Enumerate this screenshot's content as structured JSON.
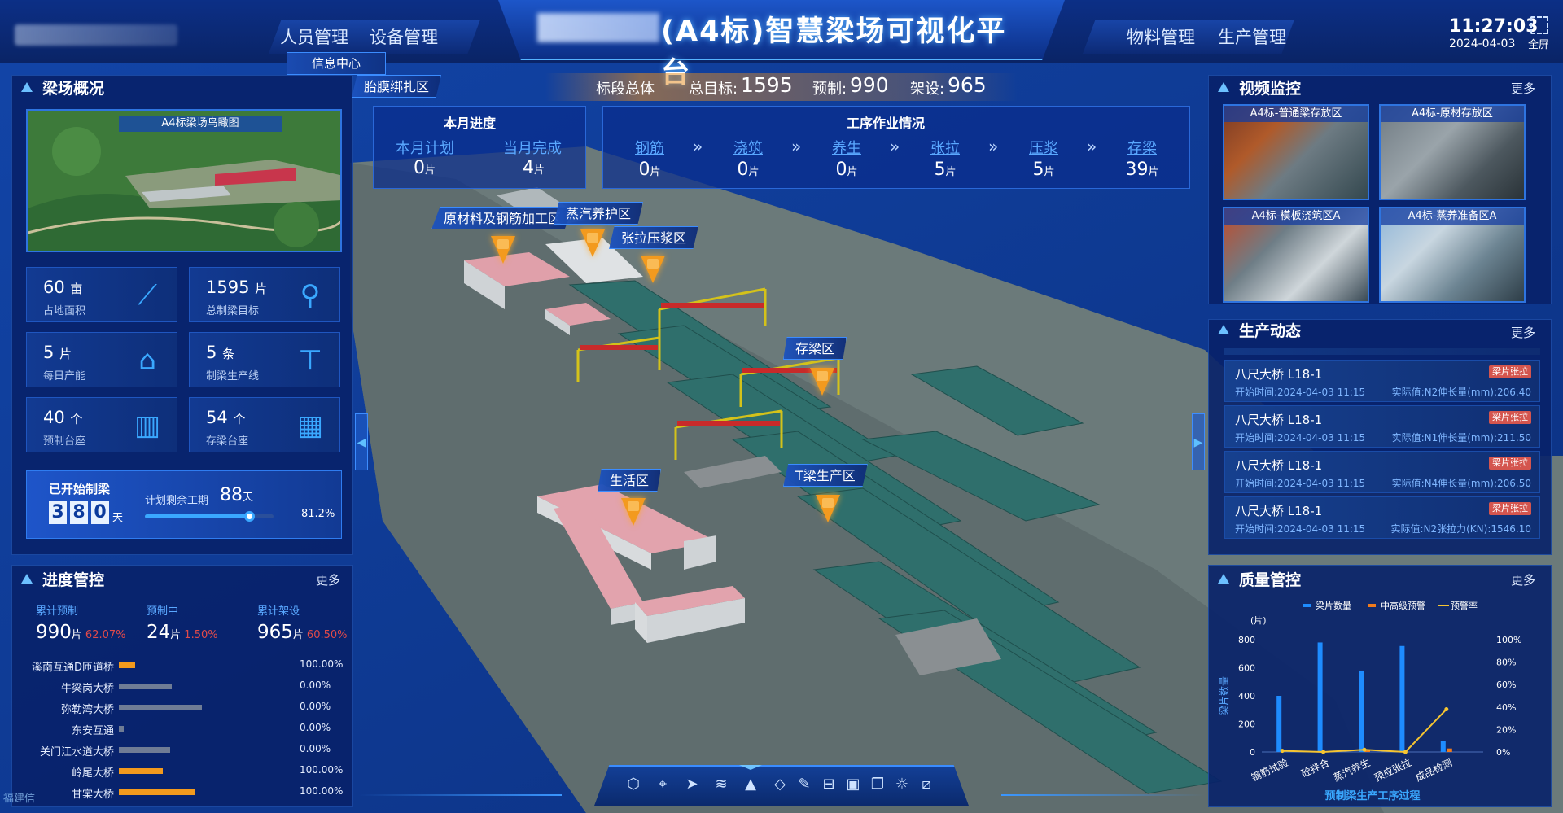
{
  "header": {
    "platform_title": "(A4标)智慧梁场可视化平台",
    "nav_left": [
      "人员管理",
      "设备管理"
    ],
    "nav_right": [
      "物料管理",
      "生产管理"
    ],
    "time": "11:27:03",
    "date": "2024-04-03",
    "fullscreen_label": "全屏",
    "sub_tab": "信息中心"
  },
  "summary_bar": {
    "label": "标段总体",
    "total_label": "总目标:",
    "total_value": "1595",
    "precast_label": "预制:",
    "precast_value": "990",
    "erect_label": "架设:",
    "erect_value": "965"
  },
  "monthly": {
    "title": "本月进度",
    "plan_label": "本月计划",
    "plan_value": "0",
    "done_label": "当月完成",
    "done_value": "4",
    "unit": "片"
  },
  "workflow": {
    "title": "工序作业情况",
    "unit": "片",
    "items": [
      {
        "name": "钢筋",
        "value": "0"
      },
      {
        "name": "浇筑",
        "value": "0"
      },
      {
        "name": "养生",
        "value": "0"
      },
      {
        "name": "张拉",
        "value": "5"
      },
      {
        "name": "压浆",
        "value": "5"
      },
      {
        "name": "存梁",
        "value": "39"
      }
    ],
    "separator": "»"
  },
  "overview": {
    "title": "梁场概况",
    "image_label": "A4标梁场鸟瞰图",
    "stats": [
      {
        "value": "60",
        "unit": "亩",
        "label": "占地面积",
        "icon": "measure-icon"
      },
      {
        "value": "1595",
        "unit": "片",
        "label": "总制梁目标",
        "icon": "crane-hook-icon"
      },
      {
        "value": "5",
        "unit": "片",
        "label": "每日产能",
        "icon": "factory-icon"
      },
      {
        "value": "5",
        "unit": "条",
        "label": "制梁生产线",
        "icon": "beam-line-icon"
      },
      {
        "value": "40",
        "unit": "个",
        "label": "预制台座",
        "icon": "pedestal-icon"
      },
      {
        "value": "54",
        "unit": "个",
        "label": "存梁台座",
        "icon": "storage-pedestal-icon"
      }
    ],
    "started_label": "已开始制梁",
    "started_days": [
      "3",
      "8",
      "0"
    ],
    "days_unit": "天",
    "remaining_label": "计划剩余工期",
    "remaining_value": "88",
    "remaining_unit": "天",
    "progress_pct_text": "81.2%",
    "progress_fraction": 0.812
  },
  "schedule": {
    "title": "进度管控",
    "more": "更多",
    "summary": [
      {
        "label": "累计预制",
        "value": "990",
        "unit": "片",
        "pct": "62.07%"
      },
      {
        "label": "预制中",
        "value": "24",
        "unit": "片",
        "pct": "1.50%"
      },
      {
        "label": "累计架设",
        "value": "965",
        "unit": "片",
        "pct": "60.50%"
      }
    ],
    "rows": [
      {
        "name": "溪南互通D匝道桥",
        "pct": "100.00%",
        "fill": 0.13,
        "color": "#f29a1d"
      },
      {
        "name": "牛梁岗大桥",
        "pct": "0.00%",
        "fill": 0.43,
        "color": "#6f7c95"
      },
      {
        "name": "弥勒湾大桥",
        "pct": "0.00%",
        "fill": 0.68,
        "color": "#6f7c95"
      },
      {
        "name": "东安互通",
        "pct": "0.00%",
        "fill": 0.04,
        "color": "#6f7c95"
      },
      {
        "name": "关门江水道大桥",
        "pct": "0.00%",
        "fill": 0.42,
        "color": "#6f7c95"
      },
      {
        "name": "岭尾大桥",
        "pct": "100.00%",
        "fill": 0.36,
        "color": "#f29a1d"
      },
      {
        "name": "甘棠大桥",
        "pct": "100.00%",
        "fill": 0.62,
        "color": "#f29a1d"
      }
    ]
  },
  "video": {
    "title": "视频监控",
    "more": "更多",
    "tiles": [
      "A4标-普通梁存放区",
      "A4标-原材存放区",
      "A4标-模板浇筑区A",
      "A4标-蒸养准备区A"
    ]
  },
  "feed": {
    "title": "生产动态",
    "more": "更多",
    "items": [
      {
        "title": "八尺大桥 L18-1",
        "badge": "梁片张拉",
        "time": "开始时间:2024-04-03 11:15",
        "value": "实际值:N2伸长量(mm):206.40"
      },
      {
        "title": "八尺大桥 L18-1",
        "badge": "梁片张拉",
        "time": "开始时间:2024-04-03 11:15",
        "value": "实际值:N1伸长量(mm):211.50"
      },
      {
        "title": "八尺大桥 L18-1",
        "badge": "梁片张拉",
        "time": "开始时间:2024-04-03 11:15",
        "value": "实际值:N4伸长量(mm):206.50"
      },
      {
        "title": "八尺大桥 L18-1",
        "badge": "梁片张拉",
        "time": "开始时间:2024-04-03 11:15",
        "value": "实际值:N2张拉力(KN):1546.10"
      }
    ]
  },
  "scene_labels": [
    "胎膜绑扎区",
    "原材料及钢筋加工区",
    "蒸汽养护区",
    "张拉压浆区",
    "存梁区",
    "生活区",
    "T梁生产区"
  ],
  "quality": {
    "title": "质量管控",
    "more": "更多",
    "chart_data": {
      "type": "bar",
      "categories": [
        "钢筋试验",
        "砼拌合",
        "蒸汽养生",
        "预应张拉",
        "成品检测"
      ],
      "series": [
        {
          "name": "梁片数量",
          "values": [
            400,
            780,
            580,
            755,
            80
          ],
          "color": "#1e8cff",
          "axis": "left"
        },
        {
          "name": "中高级预警",
          "values": [
            0,
            0,
            10,
            0,
            25
          ],
          "color": "#f07b1c",
          "axis": "left"
        },
        {
          "name": "预警率",
          "values": [
            1,
            0,
            2,
            0,
            38
          ],
          "color": "#f6c531",
          "axis": "right",
          "kind": "line"
        }
      ],
      "ylabel": "梁片数量",
      "yunit": "(片)",
      "ylim": [
        0,
        800
      ],
      "yticks": [
        "800",
        "600",
        "400",
        "200",
        "0"
      ],
      "y2lim": [
        0,
        100
      ],
      "y2ticks": [
        "100%",
        "80%",
        "60%",
        "40%",
        "20%",
        "0%"
      ],
      "xlabel": "预制梁生产工序过程"
    }
  },
  "footer": {
    "logo_text": "福建信"
  },
  "colors": {
    "accent": "#3aa8ff",
    "warning": "#f39a1e",
    "badge": "#d4554e"
  }
}
